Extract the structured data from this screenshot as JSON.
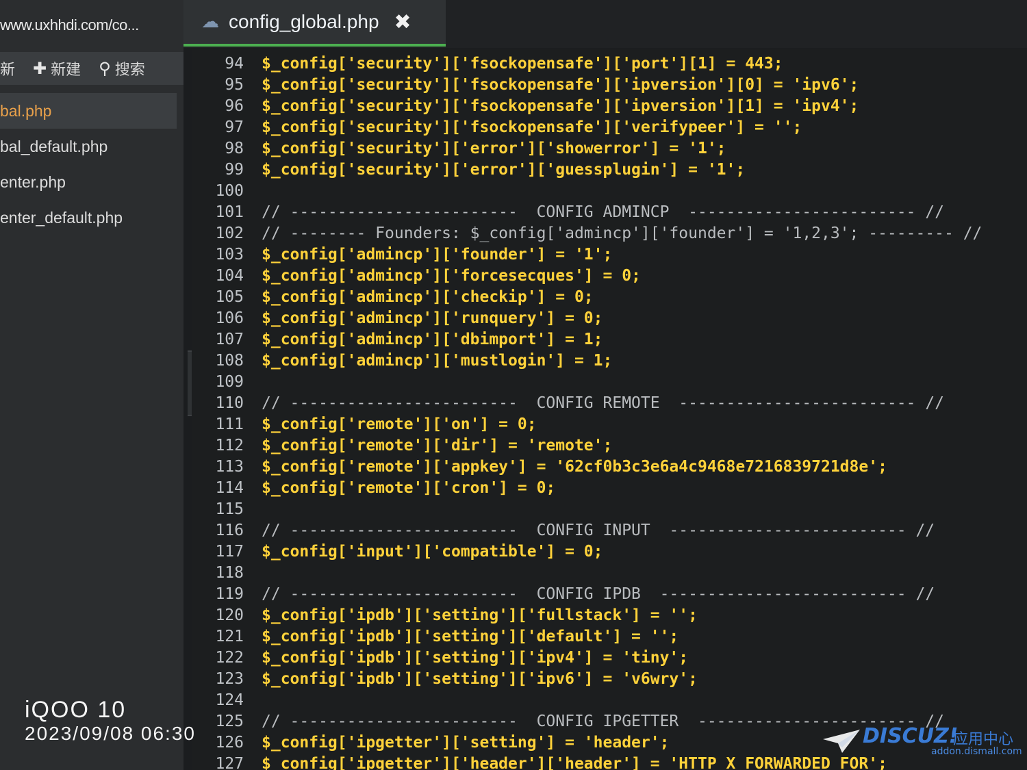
{
  "sidebar": {
    "site_url": "www.uxhhdi.com/co...",
    "toolbar": {
      "refresh_label": "新",
      "new_label": "新建",
      "search_label": "搜索"
    },
    "files": [
      {
        "name": "bal.php",
        "active": true
      },
      {
        "name": "bal_default.php",
        "active": false
      },
      {
        "name": "enter.php",
        "active": false
      },
      {
        "name": "enter_default.php",
        "active": false
      }
    ],
    "collapse_glyph": "‹"
  },
  "tabbar": {
    "tab_title": "config_global.php",
    "close_glyph": "✖"
  },
  "editor": {
    "lines": [
      {
        "n": "94",
        "kind": "var",
        "text": "$_config['security']['fsockopensafe']['port'][1] = 443;"
      },
      {
        "n": "95",
        "kind": "var",
        "text": "$_config['security']['fsockopensafe']['ipversion'][0] = 'ipv6';"
      },
      {
        "n": "96",
        "kind": "var",
        "text": "$_config['security']['fsockopensafe']['ipversion'][1] = 'ipv4';"
      },
      {
        "n": "97",
        "kind": "var",
        "text": "$_config['security']['fsockopensafe']['verifypeer'] = '';"
      },
      {
        "n": "98",
        "kind": "var",
        "text": "$_config['security']['error']['showerror'] = '1';"
      },
      {
        "n": "99",
        "kind": "var",
        "text": "$_config['security']['error']['guessplugin'] = '1';"
      },
      {
        "n": "100",
        "kind": "blank",
        "text": ""
      },
      {
        "n": "101",
        "kind": "comment",
        "text": "// ------------------------  CONFIG ADMINCP  ------------------------ //"
      },
      {
        "n": "102",
        "kind": "comment",
        "text": "// -------- Founders: $_config['admincp']['founder'] = '1,2,3'; --------- //"
      },
      {
        "n": "103",
        "kind": "var",
        "text": "$_config['admincp']['founder'] = '1';"
      },
      {
        "n": "104",
        "kind": "var",
        "text": "$_config['admincp']['forcesecques'] = 0;"
      },
      {
        "n": "105",
        "kind": "var",
        "text": "$_config['admincp']['checkip'] = 0;"
      },
      {
        "n": "106",
        "kind": "var",
        "text": "$_config['admincp']['runquery'] = 0;"
      },
      {
        "n": "107",
        "kind": "var",
        "text": "$_config['admincp']['dbimport'] = 1;"
      },
      {
        "n": "108",
        "kind": "var",
        "text": "$_config['admincp']['mustlogin'] = 1;"
      },
      {
        "n": "109",
        "kind": "blank",
        "text": ""
      },
      {
        "n": "110",
        "kind": "comment",
        "text": "// ------------------------  CONFIG REMOTE  ------------------------- //"
      },
      {
        "n": "111",
        "kind": "var",
        "text": "$_config['remote']['on'] = 0;"
      },
      {
        "n": "112",
        "kind": "var",
        "text": "$_config['remote']['dir'] = 'remote';"
      },
      {
        "n": "113",
        "kind": "var",
        "text": "$_config['remote']['appkey'] = '62cf0b3c3e6a4c9468e7216839721d8e';"
      },
      {
        "n": "114",
        "kind": "var",
        "text": "$_config['remote']['cron'] = 0;"
      },
      {
        "n": "115",
        "kind": "blank",
        "text": ""
      },
      {
        "n": "116",
        "kind": "comment",
        "text": "// ------------------------  CONFIG INPUT  ------------------------- //"
      },
      {
        "n": "117",
        "kind": "var",
        "text": "$_config['input']['compatible'] = 0;"
      },
      {
        "n": "118",
        "kind": "blank",
        "text": ""
      },
      {
        "n": "119",
        "kind": "comment",
        "text": "// ------------------------  CONFIG IPDB  -------------------------- //"
      },
      {
        "n": "120",
        "kind": "var",
        "text": "$_config['ipdb']['setting']['fullstack'] = '';"
      },
      {
        "n": "121",
        "kind": "var",
        "text": "$_config['ipdb']['setting']['default'] = '';"
      },
      {
        "n": "122",
        "kind": "var",
        "text": "$_config['ipdb']['setting']['ipv4'] = 'tiny';"
      },
      {
        "n": "123",
        "kind": "var",
        "text": "$_config['ipdb']['setting']['ipv6'] = 'v6wry';"
      },
      {
        "n": "124",
        "kind": "blank",
        "text": ""
      },
      {
        "n": "125",
        "kind": "comment",
        "text": "// ------------------------  CONFIG IPGETTER  ----------------------- //"
      },
      {
        "n": "126",
        "kind": "var",
        "text": "$_config['ipgetter']['setting'] = 'header';"
      },
      {
        "n": "127",
        "kind": "var",
        "text": "$_config['ipgetter']['header']['header'] = 'HTTP_X_FORWARDED_FOR';"
      }
    ]
  },
  "overlay": {
    "device": "iQOO 10",
    "datetime": "2023/09/08 06:30",
    "brand": "DISCUZ!",
    "brand_cn": "应用中心",
    "brand_url": "addon.dismall.com"
  },
  "colors": {
    "accent_tab_underline": "#4caf50",
    "code_var": "#ffd23a",
    "active_file": "#e8a04a"
  }
}
